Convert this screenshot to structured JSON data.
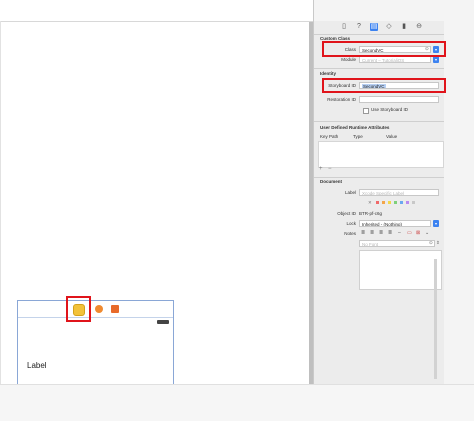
{
  "canvas": {
    "scene_label": "Label"
  },
  "inspector": {
    "tabs": [
      "file-icon",
      "help-icon",
      "identity-icon",
      "attributes-icon",
      "size-icon",
      "connections-icon"
    ],
    "custom_class": {
      "section_title": "Custom Class",
      "class_label": "Class",
      "class_value": "SecondVC",
      "module_label": "Module",
      "module_placeholder": "Current – TutorialiOS"
    },
    "identity": {
      "section_title": "Identity",
      "storyboard_id_label": "Storyboard ID",
      "storyboard_id_value": "SecondVC",
      "restoration_id_label": "Restoration ID",
      "use_storyboard_id_label": "Use Storyboard ID"
    },
    "runtime_attributes": {
      "section_title": "User Defined Runtime Attributes",
      "columns": [
        "Key Path",
        "Type",
        "Value"
      ],
      "add_symbol": "+",
      "remove_symbol": "−"
    },
    "document": {
      "section_title": "Document",
      "label_label": "Label",
      "label_placeholder": "Xcode Specific Label",
      "clear_symbol": "✕",
      "object_id_label": "Object ID",
      "object_id_value": "BTR-pf-c6g",
      "lock_label": "Lock",
      "lock_value": "Inherited - (Nothing)",
      "notes_label": "Notes",
      "notes_font_placeholder": "No Font"
    },
    "colors": {
      "accent": "#3c82f0",
      "highlight": "#e0141b",
      "swatches": [
        "#f06a6a",
        "#f3a64a",
        "#f2d84a",
        "#7fd07a",
        "#6aa8f0",
        "#b98af0",
        "#c8c8c8"
      ]
    }
  }
}
